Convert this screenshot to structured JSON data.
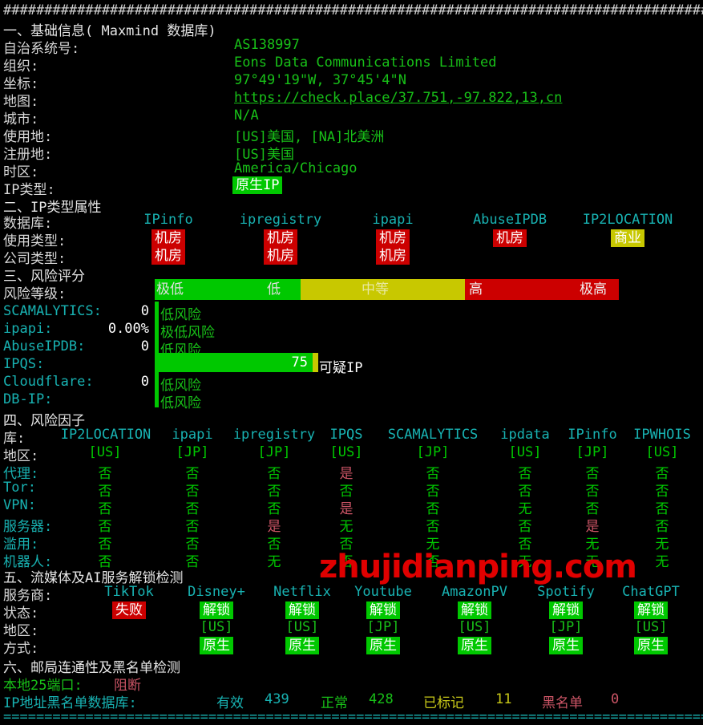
{
  "header": {
    "hash_line": "##########################################################################################",
    "eq_line": "==========================================================================================="
  },
  "section1": {
    "title": "一、基础信息( Maxmind 数据库)",
    "rows": [
      {
        "label": "自治系统号:",
        "value": "AS138997"
      },
      {
        "label": "组织:",
        "value": "Eons Data Communications Limited"
      },
      {
        "label": "坐标:",
        "value": "97°49'19\"W, 37°45'4\"N"
      },
      {
        "label": "地图:",
        "value": "https://check.place/37.751,-97.822,13,cn"
      },
      {
        "label": "城市:",
        "value": "N/A"
      },
      {
        "label": "使用地:",
        "value": "[US]美国, [NA]北美洲"
      },
      {
        "label": "注册地:",
        "value": "[US]美国"
      },
      {
        "label": "时区:",
        "value": "America/Chicago"
      },
      {
        "label": "IP类型:",
        "value": "原生IP"
      }
    ]
  },
  "section2": {
    "title": "二、IP类型属性",
    "row_labels": [
      "数据库:",
      "使用类型:",
      "公司类型:"
    ],
    "columns": [
      {
        "name": "IPinfo",
        "usage": "机房",
        "usage_color": "red",
        "company": "机房",
        "company_color": "red"
      },
      {
        "name": "ipregistry",
        "usage": "机房",
        "usage_color": "red",
        "company": "机房",
        "company_color": "red"
      },
      {
        "name": "ipapi",
        "usage": "机房",
        "usage_color": "red",
        "company": "机房",
        "company_color": "red"
      },
      {
        "name": "AbuseIPDB",
        "usage": "机房",
        "usage_color": "red",
        "company": "",
        "company_color": ""
      },
      {
        "name": "IP2LOCATION",
        "usage": "商业",
        "usage_color": "yellow",
        "company": "",
        "company_color": ""
      }
    ]
  },
  "section3": {
    "title": "三、风险评分",
    "scale_label": "风险等级:",
    "scale_segments": [
      {
        "label": "极低",
        "color": "#00c800"
      },
      {
        "label": "低",
        "color": "#00c800"
      },
      {
        "label": "中等",
        "color": "#c8c800"
      },
      {
        "label": "高",
        "color": "#cc0000"
      },
      {
        "label": "极高",
        "color": "#cc0000"
      }
    ],
    "scores": [
      {
        "name": "SCAMALYTICS:",
        "value": "0",
        "verdict": "低风险",
        "bar_pct": 0
      },
      {
        "name": "ipapi:",
        "value": "0.00%",
        "verdict": "极低风险",
        "bar_pct": 0
      },
      {
        "name": "AbuseIPDB:",
        "value": "0",
        "verdict": "低风险",
        "bar_pct": 0
      },
      {
        "name": "IPQS:",
        "value": "75",
        "verdict": "可疑IP",
        "bar_pct": 75
      },
      {
        "name": "Cloudflare:",
        "value": "0",
        "verdict": "低风险",
        "bar_pct": 0
      },
      {
        "name": "DB-IP:",
        "value": "",
        "verdict": "低风险",
        "bar_pct": 0
      }
    ]
  },
  "section4": {
    "title": "四、风险因子",
    "db_label": "库:",
    "databases": [
      "IP2LOCATION",
      "ipapi",
      "ipregistry",
      "IPQS",
      "SCAMALYTICS",
      "ipdata",
      "IPinfo",
      "IPWHOIS"
    ],
    "rows": [
      {
        "label": "地区:",
        "values": [
          "[US]",
          "[JP]",
          "[JP]",
          "[US]",
          "[JP]",
          "[US]",
          "[JP]",
          "[US]"
        ],
        "colors": [
          "green",
          "green",
          "green",
          "green",
          "green",
          "green",
          "green",
          "green"
        ]
      },
      {
        "label": "代理:",
        "values": [
          "否",
          "否",
          "否",
          "是",
          "否",
          "否",
          "否",
          "否"
        ],
        "colors": [
          "green",
          "green",
          "green",
          "pink",
          "green",
          "green",
          "green",
          "green"
        ]
      },
      {
        "label": "Tor:",
        "values": [
          "否",
          "否",
          "否",
          "否",
          "否",
          "否",
          "否",
          "否"
        ],
        "colors": [
          "green",
          "green",
          "green",
          "green",
          "green",
          "green",
          "green",
          "green"
        ]
      },
      {
        "label": "VPN:",
        "values": [
          "否",
          "否",
          "否",
          "是",
          "否",
          "无",
          "否",
          "否"
        ],
        "colors": [
          "green",
          "green",
          "green",
          "pink",
          "green",
          "green",
          "green",
          "green"
        ]
      },
      {
        "label": "服务器:",
        "values": [
          "否",
          "否",
          "是",
          "无",
          "否",
          "否",
          "是",
          "否"
        ],
        "colors": [
          "green",
          "green",
          "pink",
          "green",
          "green",
          "green",
          "pink",
          "green"
        ]
      },
      {
        "label": "滥用:",
        "values": [
          "否",
          "否",
          "否",
          "否",
          "无",
          "否",
          "无",
          "无"
        ],
        "colors": [
          "green",
          "green",
          "green",
          "green",
          "green",
          "green",
          "green",
          "green"
        ]
      },
      {
        "label": "机器人:",
        "values": [
          "否",
          "否",
          "无",
          "否",
          "否",
          "无",
          "无",
          "无"
        ],
        "colors": [
          "green",
          "green",
          "green",
          "green",
          "green",
          "green",
          "green",
          "green"
        ]
      }
    ]
  },
  "section5": {
    "title": "五、流媒体及AI服务解锁检测",
    "row_labels": [
      "服务商:",
      "状态:",
      "地区:",
      "方式:"
    ],
    "providers": [
      {
        "name": "TikTok",
        "status": "失败",
        "status_color": "red",
        "region": "",
        "method": ""
      },
      {
        "name": "Disney+",
        "status": "解锁",
        "status_color": "green",
        "region": "[US]",
        "method": "原生"
      },
      {
        "name": "Netflix",
        "status": "解锁",
        "status_color": "green",
        "region": "[US]",
        "method": "原生"
      },
      {
        "name": "Youtube",
        "status": "解锁",
        "status_color": "green",
        "region": "[JP]",
        "method": "原生"
      },
      {
        "name": "AmazonPV",
        "status": "解锁",
        "status_color": "green",
        "region": "[US]",
        "method": "原生"
      },
      {
        "name": "Spotify",
        "status": "解锁",
        "status_color": "green",
        "region": "[JP]",
        "method": "原生"
      },
      {
        "name": "ChatGPT",
        "status": "解锁",
        "status_color": "green",
        "region": "[US]",
        "method": "原生"
      }
    ]
  },
  "section6": {
    "title": "六、邮局连通性及黑名单检测",
    "port_label": "本地25端口:",
    "port_value": "阻断",
    "blacklist_label": "IP地址黑名单数据库:",
    "blacklist_stats": [
      {
        "label": "有效",
        "value": "439",
        "color": "cyan"
      },
      {
        "label": "正常",
        "value": "428",
        "color": "green"
      },
      {
        "label": "已标记",
        "value": "11",
        "color": "yellow"
      },
      {
        "label": "黑名单",
        "value": "0",
        "color": "pink"
      }
    ]
  },
  "watermark": {
    "text": "zhujidianping.com"
  },
  "colors": {
    "red": "#cc0000",
    "green": "#00c800",
    "yellow": "#c8c800",
    "cyan": "#18b2b2",
    "pink": "#cc5566"
  }
}
